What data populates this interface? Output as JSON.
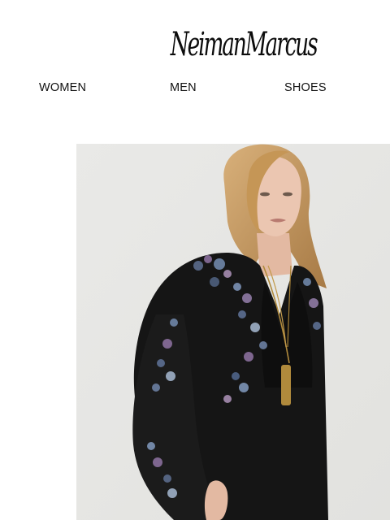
{
  "brand": {
    "logo_text": "NeimanMarcus"
  },
  "nav": {
    "items": [
      {
        "label": "WOMEN"
      },
      {
        "label": "MEN"
      },
      {
        "label": "SHOES"
      }
    ]
  },
  "hero": {
    "colors": {
      "background": "#e7e7e5",
      "garment": "#151515",
      "hair": "#c89a5c",
      "skin": "#e9c3ad",
      "gold": "#b08a3c"
    }
  }
}
